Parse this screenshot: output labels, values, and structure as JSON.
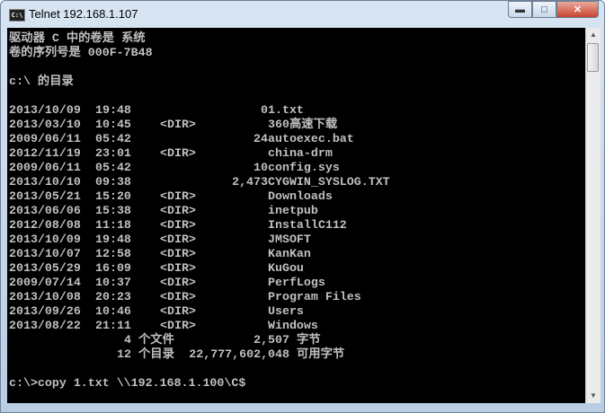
{
  "window": {
    "title": "Telnet 192.168.1.107",
    "icon_label": "C:\\"
  },
  "header": {
    "line1": "驱动器 C 中的卷是 系统",
    "line2": "卷的序列号是 000F-7B48",
    "dir_line": "c:\\ 的目录"
  },
  "entries": [
    {
      "date": "2013/10/09",
      "time": "19:48",
      "type": "",
      "size": "0",
      "name": "1.txt"
    },
    {
      "date": "2013/03/10",
      "time": "10:45",
      "type": "<DIR>",
      "size": "",
      "name": "360高速下载"
    },
    {
      "date": "2009/06/11",
      "time": "05:42",
      "type": "",
      "size": "24",
      "name": "autoexec.bat"
    },
    {
      "date": "2012/11/19",
      "time": "23:01",
      "type": "<DIR>",
      "size": "",
      "name": "china-drm"
    },
    {
      "date": "2009/06/11",
      "time": "05:42",
      "type": "",
      "size": "10",
      "name": "config.sys"
    },
    {
      "date": "2013/10/10",
      "time": "09:38",
      "type": "",
      "size": "2,473",
      "name": "CYGWIN_SYSLOG.TXT"
    },
    {
      "date": "2013/05/21",
      "time": "15:20",
      "type": "<DIR>",
      "size": "",
      "name": "Downloads"
    },
    {
      "date": "2013/06/06",
      "time": "15:38",
      "type": "<DIR>",
      "size": "",
      "name": "inetpub"
    },
    {
      "date": "2012/08/08",
      "time": "11:18",
      "type": "<DIR>",
      "size": "",
      "name": "InstallC112"
    },
    {
      "date": "2013/10/09",
      "time": "19:48",
      "type": "<DIR>",
      "size": "",
      "name": "JMSOFT"
    },
    {
      "date": "2013/10/07",
      "time": "12:58",
      "type": "<DIR>",
      "size": "",
      "name": "KanKan"
    },
    {
      "date": "2013/05/29",
      "time": "16:09",
      "type": "<DIR>",
      "size": "",
      "name": "KuGou"
    },
    {
      "date": "2009/07/14",
      "time": "10:37",
      "type": "<DIR>",
      "size": "",
      "name": "PerfLogs"
    },
    {
      "date": "2013/10/08",
      "time": "20:23",
      "type": "<DIR>",
      "size": "",
      "name": "Program Files"
    },
    {
      "date": "2013/09/26",
      "time": "10:46",
      "type": "<DIR>",
      "size": "",
      "name": "Users"
    },
    {
      "date": "2013/08/22",
      "time": "21:11",
      "type": "<DIR>",
      "size": "",
      "name": "Windows"
    }
  ],
  "summary": {
    "files_count": "4",
    "files_label": "个文件",
    "files_bytes": "2,507",
    "bytes_label": "字节",
    "dirs_count": "12",
    "dirs_label": "个目录",
    "free_bytes": "22,777,602,048",
    "free_label": "可用字节"
  },
  "prompt": {
    "text": "c:\\>copy 1.txt \\\\192.168.1.100\\C$"
  }
}
